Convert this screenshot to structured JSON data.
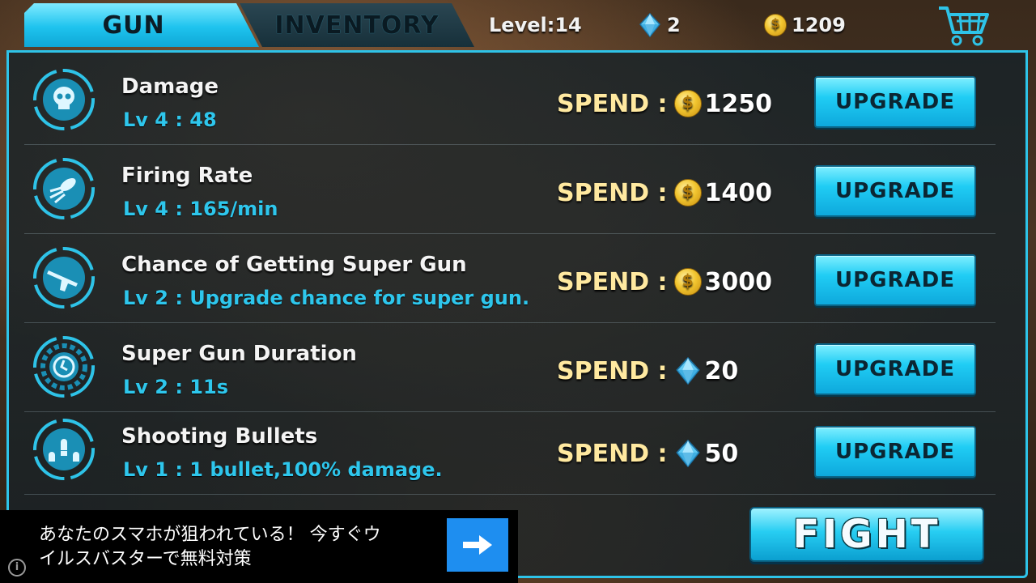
{
  "tabs": [
    {
      "label": "GUN",
      "active": true
    },
    {
      "label": "INVENTORY",
      "active": false
    }
  ],
  "status": {
    "level": "Level:14",
    "gems": "2",
    "coins": "1209"
  },
  "upgrades": [
    {
      "title": "Damage",
      "level": "Lv 4 : 48",
      "spend_label": "SPEND :",
      "currency": "coin",
      "cost": "1250",
      "button": "UPGRADE",
      "icon": "skull-icon"
    },
    {
      "title": "Firing Rate",
      "level": "Lv 4 : 165/min",
      "spend_label": "SPEND :",
      "currency": "coin",
      "cost": "1400",
      "button": "UPGRADE",
      "icon": "bullet-burst-icon"
    },
    {
      "title": "Chance of Getting Super Gun",
      "level": "Lv 2 : Upgrade chance for super gun.",
      "spend_label": "SPEND :",
      "currency": "coin",
      "cost": "3000",
      "button": "UPGRADE",
      "icon": "rifle-icon"
    },
    {
      "title": "Super Gun Duration",
      "level": "Lv 2 : 11s",
      "spend_label": "SPEND :",
      "currency": "gem",
      "cost": "20",
      "button": "UPGRADE",
      "icon": "clock-gear-icon"
    },
    {
      "title": "Shooting Bullets",
      "level": "Lv 1 : 1 bullet,100% damage.",
      "spend_label": "SPEND :",
      "currency": "gem",
      "cost": "50",
      "button": "UPGRADE",
      "icon": "bullets-icon"
    }
  ],
  "fight_label": "FIGHT",
  "ad": {
    "text": "あなたのスマホが狙われている！ 今すぐウ\nイルスバスターで無料対策",
    "info": "i"
  },
  "colors": {
    "accent": "#2ec3e8",
    "level_text": "#2ec6ec",
    "spend_label": "#ffe9a0",
    "ad_button": "#1e8ef0"
  }
}
